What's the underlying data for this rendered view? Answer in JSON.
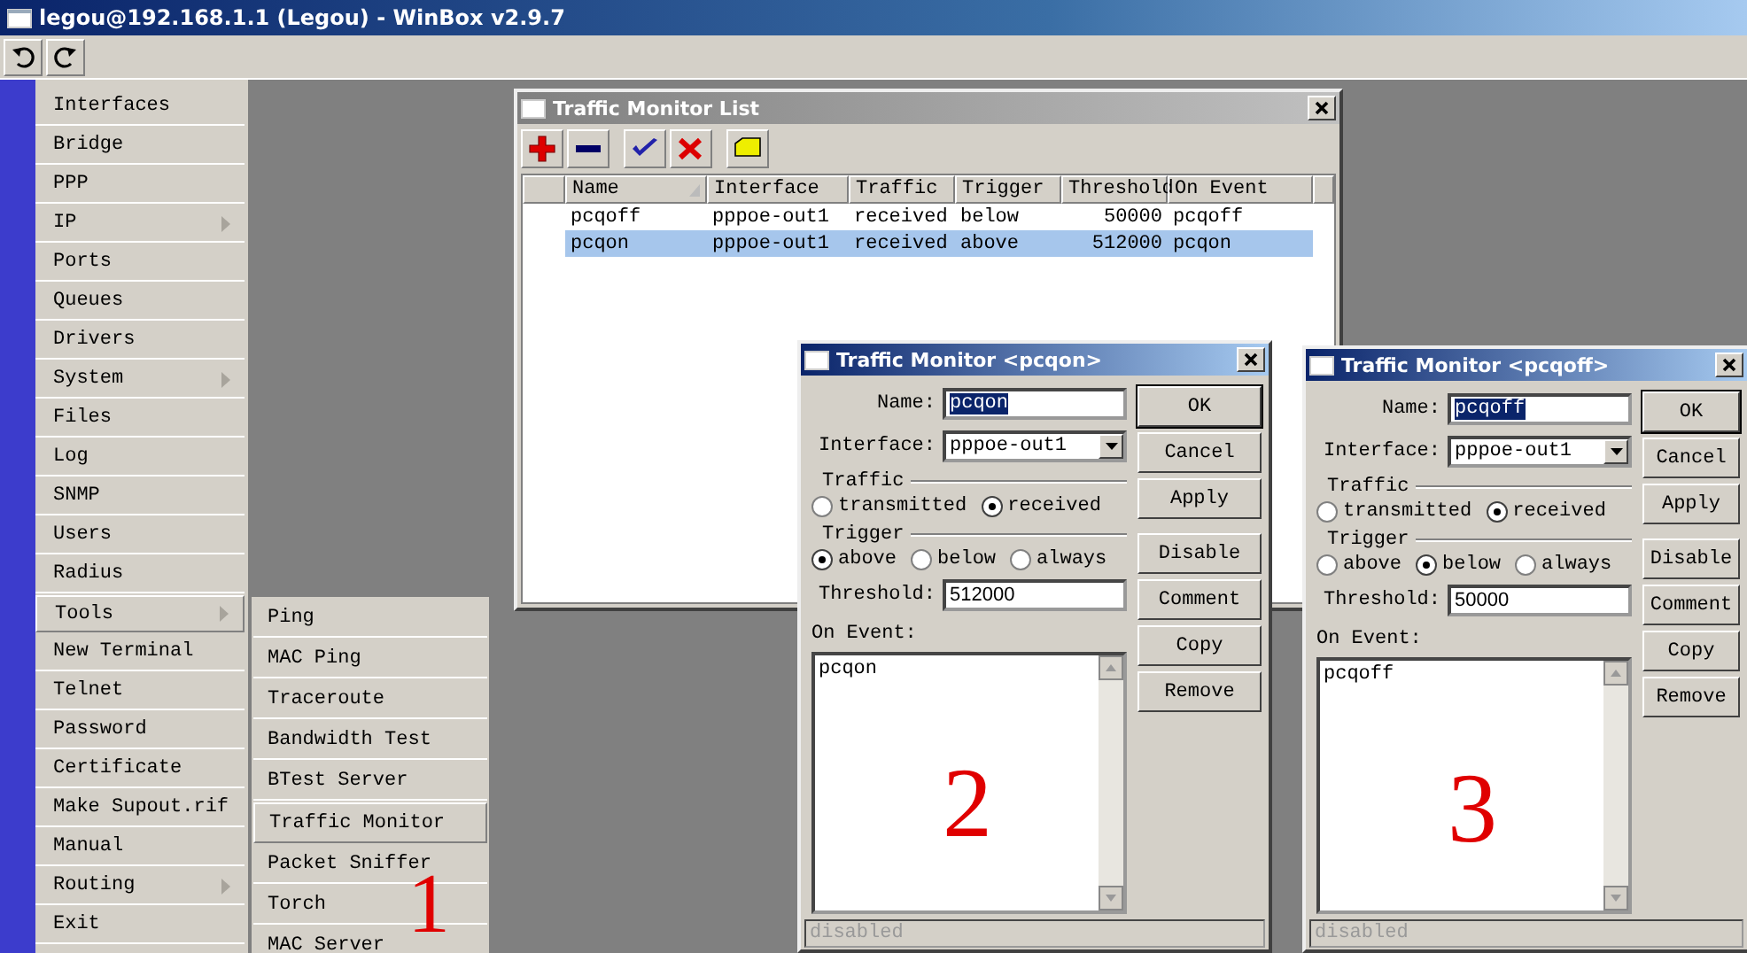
{
  "window": {
    "title": "legou@192.168.1.1 (Legou) - WinBox v2.9.7"
  },
  "menu": {
    "items": [
      {
        "label": "Interfaces",
        "has_submenu": false,
        "selected": false
      },
      {
        "label": "Bridge",
        "has_submenu": false,
        "selected": false
      },
      {
        "label": "PPP",
        "has_submenu": false,
        "selected": false
      },
      {
        "label": "IP",
        "has_submenu": true,
        "selected": false
      },
      {
        "label": "Ports",
        "has_submenu": false,
        "selected": false
      },
      {
        "label": "Queues",
        "has_submenu": false,
        "selected": false
      },
      {
        "label": "Drivers",
        "has_submenu": false,
        "selected": false
      },
      {
        "label": "System",
        "has_submenu": true,
        "selected": false
      },
      {
        "label": "Files",
        "has_submenu": false,
        "selected": false
      },
      {
        "label": "Log",
        "has_submenu": false,
        "selected": false
      },
      {
        "label": "SNMP",
        "has_submenu": false,
        "selected": false
      },
      {
        "label": "Users",
        "has_submenu": false,
        "selected": false
      },
      {
        "label": "Radius",
        "has_submenu": false,
        "selected": false
      },
      {
        "label": "Tools",
        "has_submenu": true,
        "selected": true
      },
      {
        "label": "New Terminal",
        "has_submenu": false,
        "selected": false
      },
      {
        "label": "Telnet",
        "has_submenu": false,
        "selected": false
      },
      {
        "label": "Password",
        "has_submenu": false,
        "selected": false
      },
      {
        "label": "Certificate",
        "has_submenu": false,
        "selected": false
      },
      {
        "label": "Make Supout.rif",
        "has_submenu": false,
        "selected": false
      },
      {
        "label": "Manual",
        "has_submenu": false,
        "selected": false
      },
      {
        "label": "Routing",
        "has_submenu": true,
        "selected": false
      },
      {
        "label": "Exit",
        "has_submenu": false,
        "selected": false
      }
    ]
  },
  "submenu": {
    "items": [
      {
        "label": "Ping",
        "selected": false
      },
      {
        "label": "MAC Ping",
        "selected": false
      },
      {
        "label": "Traceroute",
        "selected": false
      },
      {
        "label": "Bandwidth Test",
        "selected": false
      },
      {
        "label": "BTest Server",
        "selected": false
      },
      {
        "label": "Traffic Monitor",
        "selected": true
      },
      {
        "label": "Packet Sniffer",
        "selected": false
      },
      {
        "label": "Torch",
        "selected": false
      },
      {
        "label": "MAC Server",
        "selected": false
      }
    ],
    "annotation": "1"
  },
  "list_window": {
    "title": "Traffic Monitor List",
    "table": {
      "columns": [
        "Name",
        "Interface",
        "Traffic",
        "Trigger",
        "Threshold",
        "On Event"
      ],
      "rows": [
        {
          "cells": [
            "pcqoff",
            "pppoe-out1",
            "received",
            "below",
            "50000",
            "pcqoff"
          ],
          "selected": false
        },
        {
          "cells": [
            "pcqon",
            "pppoe-out1",
            "received",
            "above",
            "512000",
            "pcqon"
          ],
          "selected": true
        }
      ]
    }
  },
  "dialogs": [
    {
      "title": "Traffic Monitor <pcqon>",
      "name_label": "Name:",
      "name": "pcqon",
      "interface_label": "Interface:",
      "interface": "pppoe-out1",
      "traffic": {
        "label": "Traffic",
        "options": [
          {
            "label": "transmitted",
            "selected": false
          },
          {
            "label": "received",
            "selected": true
          }
        ]
      },
      "trigger": {
        "label": "Trigger",
        "options": [
          {
            "label": "above",
            "selected": true
          },
          {
            "label": "below",
            "selected": false
          },
          {
            "label": "always",
            "selected": false
          }
        ]
      },
      "threshold_label": "Threshold:",
      "threshold": "512000",
      "on_event_label": "On Event:",
      "on_event": "pcqon",
      "buttons": [
        "OK",
        "Cancel",
        "Apply",
        "Disable",
        "Comment",
        "Copy",
        "Remove"
      ],
      "status": "disabled",
      "annotation": "2"
    },
    {
      "title": "Traffic Monitor <pcqoff>",
      "name_label": "Name:",
      "name": "pcqoff",
      "interface_label": "Interface:",
      "interface": "pppoe-out1",
      "traffic": {
        "label": "Traffic",
        "options": [
          {
            "label": "transmitted",
            "selected": false
          },
          {
            "label": "received",
            "selected": true
          }
        ]
      },
      "trigger": {
        "label": "Trigger",
        "options": [
          {
            "label": "above",
            "selected": false
          },
          {
            "label": "below",
            "selected": true
          },
          {
            "label": "always",
            "selected": false
          }
        ]
      },
      "threshold_label": "Threshold:",
      "threshold": "50000",
      "on_event_label": "On Event:",
      "on_event": "pcqoff",
      "buttons": [
        "OK",
        "Cancel",
        "Apply",
        "Disable",
        "Comment",
        "Copy",
        "Remove"
      ],
      "status": "disabled",
      "annotation": "3"
    }
  ]
}
